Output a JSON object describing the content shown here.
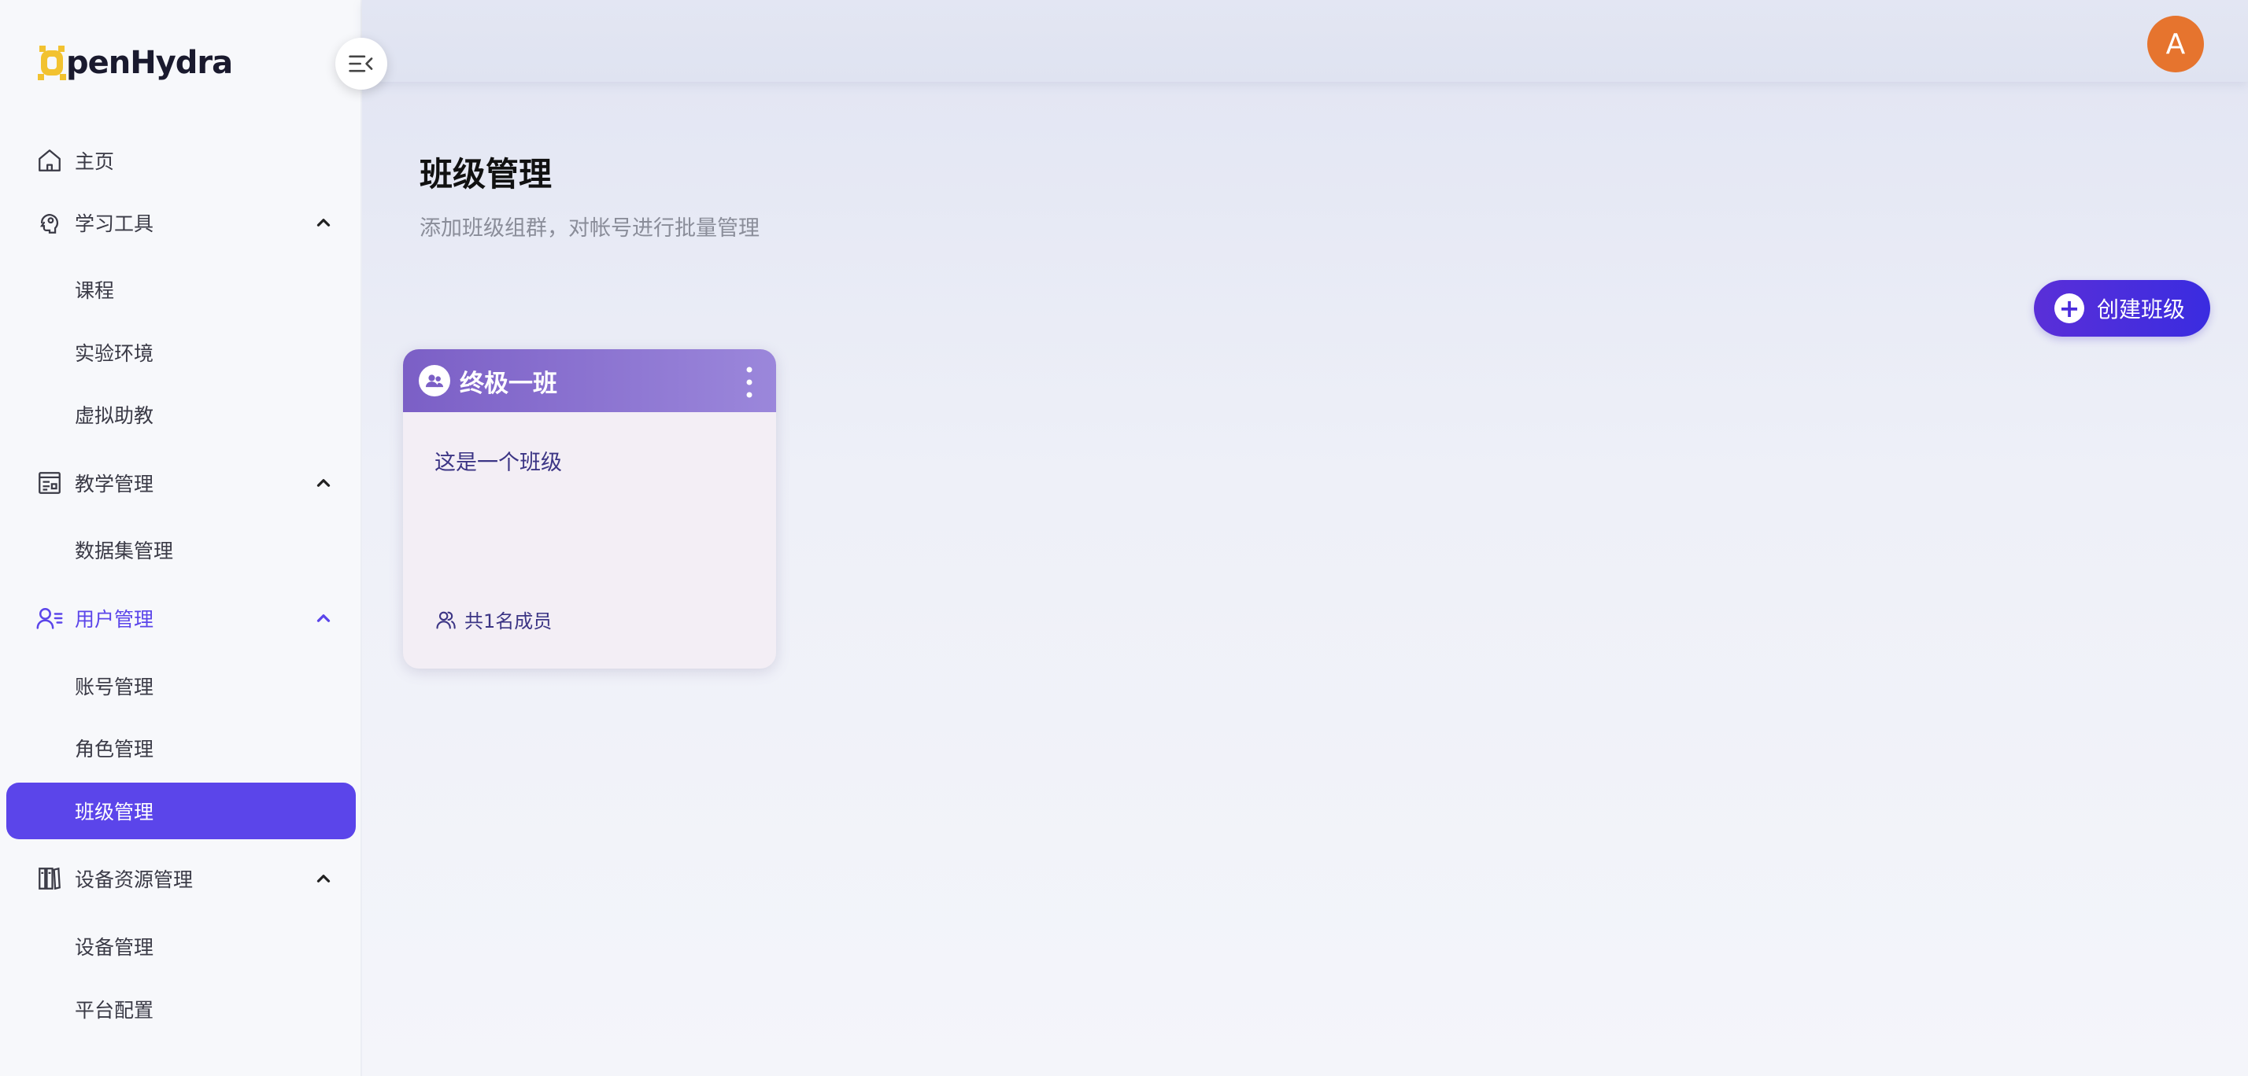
{
  "app": {
    "logo_text": "penHydra",
    "logo_letter": "O"
  },
  "sidebar": {
    "items": [
      {
        "label": "主页",
        "icon": "home-icon"
      },
      {
        "label": "学习工具",
        "icon": "brain-icon"
      },
      {
        "label": "课程"
      },
      {
        "label": "实验环境"
      },
      {
        "label": "虚拟助教"
      },
      {
        "label": "教学管理",
        "icon": "board-icon"
      },
      {
        "label": "数据集管理"
      },
      {
        "label": "用户管理",
        "icon": "users-icon"
      },
      {
        "label": "账号管理"
      },
      {
        "label": "角色管理"
      },
      {
        "label": "班级管理"
      },
      {
        "label": "设备资源管理",
        "icon": "books-icon"
      },
      {
        "label": "设备管理"
      },
      {
        "label": "平台配置"
      }
    ]
  },
  "user": {
    "avatar_initial": "A"
  },
  "page": {
    "title": "班级管理",
    "subtitle": "添加班级组群，对帐号进行批量管理",
    "create_label": "创建班级"
  },
  "classes": [
    {
      "name": "终极一班",
      "description": "这是一个班级",
      "members": "共1名成员"
    }
  ],
  "colors": {
    "accent": "#5b45ea",
    "avatar": "#e6742e",
    "card_header_start": "#7b5fc6",
    "card_header_end": "#9b87db"
  }
}
